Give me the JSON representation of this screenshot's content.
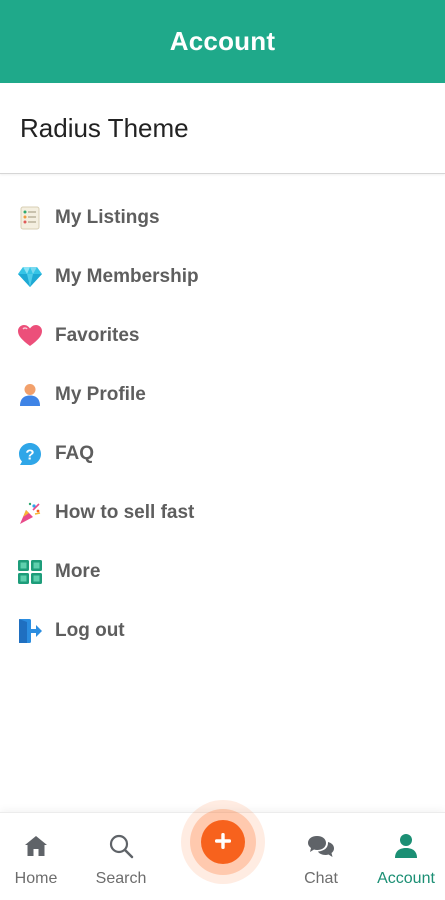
{
  "header": {
    "title": "Account"
  },
  "profile": {
    "name": "Radius Theme"
  },
  "menu": {
    "items": [
      {
        "label": "My Listings",
        "icon": "listings-icon"
      },
      {
        "label": "My Membership",
        "icon": "diamond-icon"
      },
      {
        "label": "Favorites",
        "icon": "heart-icon"
      },
      {
        "label": "My Profile",
        "icon": "user-icon"
      },
      {
        "label": "FAQ",
        "icon": "question-icon"
      },
      {
        "label": "How to sell fast",
        "icon": "party-popper-icon"
      },
      {
        "label": "More",
        "icon": "grid-icon"
      },
      {
        "label": "Log out",
        "icon": "logout-icon"
      }
    ]
  },
  "bottom_nav": {
    "home": "Home",
    "search": "Search",
    "chat": "Chat",
    "account": "Account",
    "active": "Account"
  },
  "colors": {
    "primary": "#1fa98a",
    "accent": "#f7621d",
    "active_nav": "#1b8f74"
  }
}
